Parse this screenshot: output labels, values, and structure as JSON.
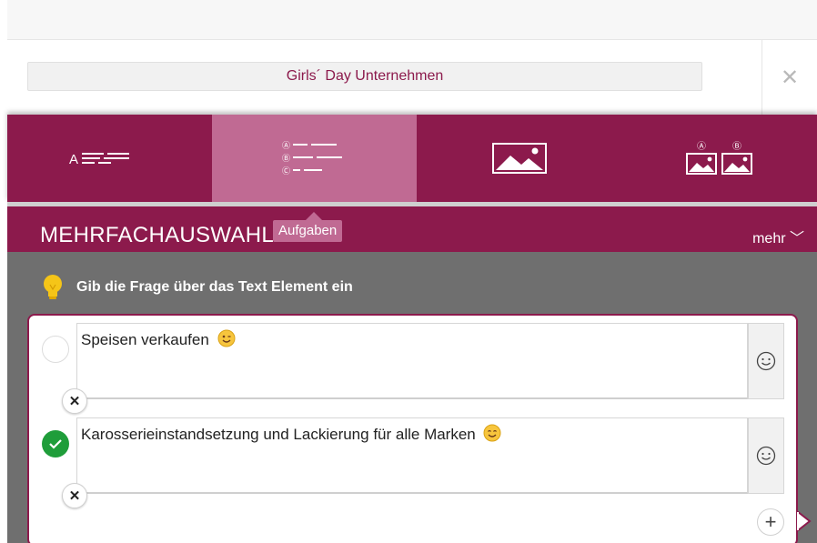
{
  "header": {
    "title": "Girls´ Day Unternehmen",
    "close_label": "✕"
  },
  "type_tabs": [
    {
      "icon": "text-lines-icon",
      "active": false
    },
    {
      "icon": "multiple-choice-list-icon",
      "active": true
    },
    {
      "icon": "image-icon",
      "active": false
    },
    {
      "icon": "image-choice-ab-icon",
      "active": false
    }
  ],
  "type_tab_letters": {
    "text_prefix": "A",
    "option_a": "Ⓐ",
    "option_b": "Ⓑ",
    "option_c": "Ⓒ"
  },
  "mode": {
    "title": "MEHRFACHAUSWAHL",
    "tooltip": "Aufgaben",
    "more": "mehr ﹀"
  },
  "hint": {
    "text": "Gib die Frage über das Text Element ein"
  },
  "answers": [
    {
      "text": "Speisen verkaufen",
      "emoji": "winking-face-emoji",
      "selected": false
    },
    {
      "text": "Karosserieinstandsetzung und Lackierung für alle Marken",
      "emoji": "smiling-face-emoji",
      "selected": true
    }
  ],
  "buttons": {
    "delete_label": "✕",
    "add_label": "+"
  },
  "colors": {
    "primary": "#8c1a4c",
    "active_tab": "#c06a93",
    "content_bg": "#6f6f6f",
    "check_green": "#1f9d3a",
    "bulb_yellow": "#f5c518"
  }
}
